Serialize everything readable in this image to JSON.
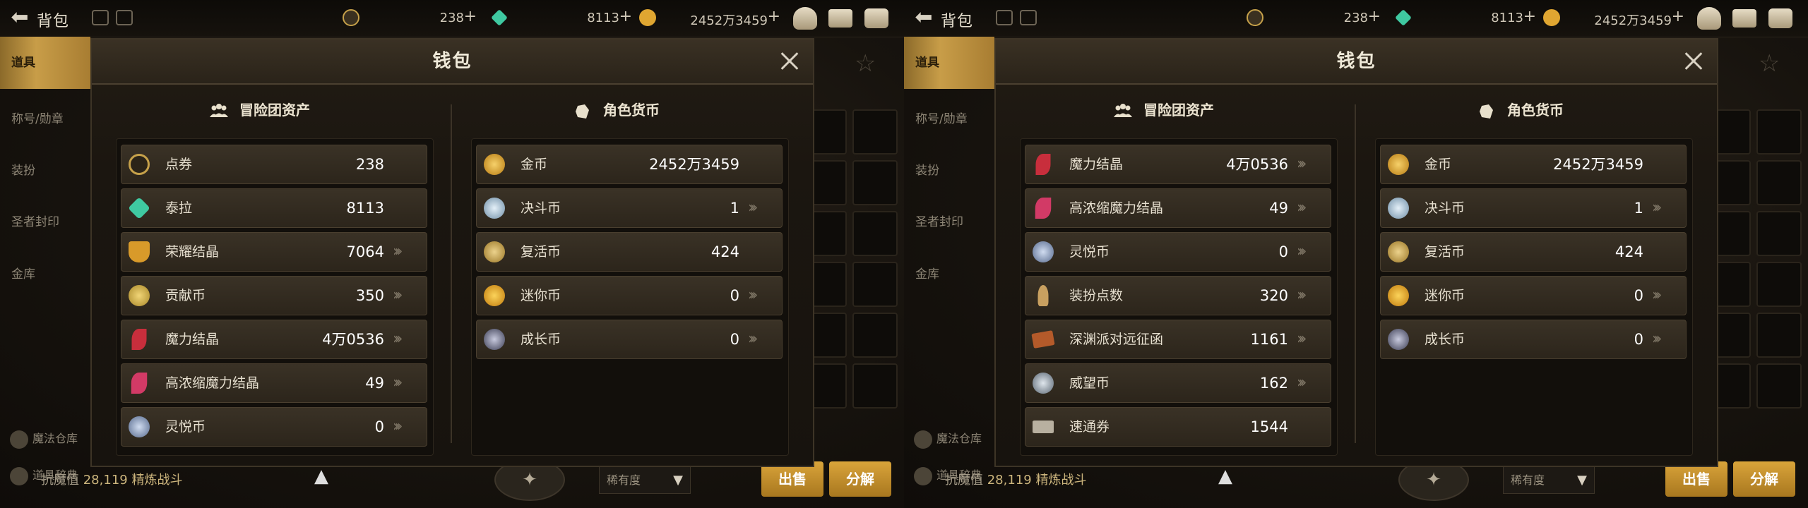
{
  "topbar": {
    "title": "背包",
    "resources": [
      {
        "name": "dianquan",
        "value": "238",
        "plus": "+",
        "color": "#c6a14a"
      },
      {
        "name": "taila",
        "value": "8113",
        "plus": "+",
        "color": "#3fc9a1"
      },
      {
        "name": "gold",
        "value": "2452万3459",
        "plus": "+",
        "color": "#e0a631"
      }
    ]
  },
  "sidebar": {
    "items": [
      "道具",
      "称号/勋章",
      "装扮",
      "圣者封印",
      "金库"
    ],
    "bottom": [
      "魔法仓库",
      "道具辞典"
    ]
  },
  "bottombar": {
    "prefix": "抗魔值",
    "value": "28,119",
    "label": "精炼战斗",
    "select": "稀有度",
    "sell": "出售",
    "disassemble": "分解"
  },
  "screens": [
    {
      "modal": {
        "title": "钱包",
        "left_title": "冒险团资产",
        "right_title": "角色货币",
        "left_rows": [
          {
            "label": "点券",
            "value": "238",
            "icon": "dianquan-icon",
            "color": "#c6a14a",
            "arrow": false
          },
          {
            "label": "泰拉",
            "value": "8113",
            "icon": "taila-icon",
            "color": "#3fc9a1",
            "arrow": false
          },
          {
            "label": "荣耀结晶",
            "value": "7064",
            "icon": "trophy-icon",
            "color": "#d89a2a",
            "arrow": true
          },
          {
            "label": "贡献币",
            "value": "350",
            "icon": "contribution-coin-icon",
            "color": "#d6b048",
            "arrow": true
          },
          {
            "label": "魔力结晶",
            "value": "4万0536",
            "icon": "magic-crystal-icon",
            "color": "#c82e3c",
            "arrow": true
          },
          {
            "label": "高浓缩魔力结晶",
            "value": "49",
            "icon": "condensed-crystal-icon",
            "color": "#d23a66",
            "arrow": true
          },
          {
            "label": "灵悦币",
            "value": "0",
            "icon": "lingyue-coin-icon",
            "color": "#8fa4c8",
            "arrow": true
          }
        ],
        "right_rows": [
          {
            "label": "金币",
            "value": "2452万3459",
            "icon": "gold-coin-icon",
            "color": "#e0a631",
            "arrow": false
          },
          {
            "label": "决斗币",
            "value": "1",
            "icon": "duel-coin-icon",
            "color": "#9dc0d8",
            "arrow": true
          },
          {
            "label": "复活币",
            "value": "424",
            "icon": "revive-coin-icon",
            "color": "#c8a048",
            "arrow": false
          },
          {
            "label": "迷你币",
            "value": "0",
            "icon": "mini-coin-icon",
            "color": "#e4a022",
            "arrow": true
          },
          {
            "label": "成长币",
            "value": "0",
            "icon": "growth-coin-icon",
            "color": "#9a9db8",
            "arrow": true
          }
        ]
      }
    },
    {
      "modal": {
        "title": "钱包",
        "left_title": "冒险团资产",
        "right_title": "角色货币",
        "left_rows": [
          {
            "label": "魔力结晶",
            "value": "4万0536",
            "icon": "magic-crystal-icon",
            "color": "#c82e3c",
            "arrow": true
          },
          {
            "label": "高浓缩魔力结晶",
            "value": "49",
            "icon": "condensed-crystal-icon",
            "color": "#d23a66",
            "arrow": true
          },
          {
            "label": "灵悦币",
            "value": "0",
            "icon": "lingyue-coin-icon",
            "color": "#8fa4c8",
            "arrow": true
          },
          {
            "label": "装扮点数",
            "value": "320",
            "icon": "avatar-point-icon",
            "color": "#c8a060",
            "arrow": true
          },
          {
            "label": "深渊派对远征函",
            "value": "1161",
            "icon": "abyss-ticket-icon",
            "color": "#b45a2a",
            "arrow": true
          },
          {
            "label": "威望币",
            "value": "162",
            "icon": "prestige-coin-icon",
            "color": "#8c9aa8",
            "arrow": true
          },
          {
            "label": "速通券",
            "value": "1544",
            "icon": "speedrun-ticket-icon",
            "color": "#b8b0a0",
            "arrow": false
          }
        ],
        "right_rows": [
          {
            "label": "金币",
            "value": "2452万3459",
            "icon": "gold-coin-icon",
            "color": "#e0a631",
            "arrow": false
          },
          {
            "label": "决斗币",
            "value": "1",
            "icon": "duel-coin-icon",
            "color": "#9dc0d8",
            "arrow": true
          },
          {
            "label": "复活币",
            "value": "424",
            "icon": "revive-coin-icon",
            "color": "#c8a048",
            "arrow": false
          },
          {
            "label": "迷你币",
            "value": "0",
            "icon": "mini-coin-icon",
            "color": "#e4a022",
            "arrow": true
          },
          {
            "label": "成长币",
            "value": "0",
            "icon": "growth-coin-icon",
            "color": "#9a9db8",
            "arrow": true
          }
        ]
      }
    }
  ]
}
